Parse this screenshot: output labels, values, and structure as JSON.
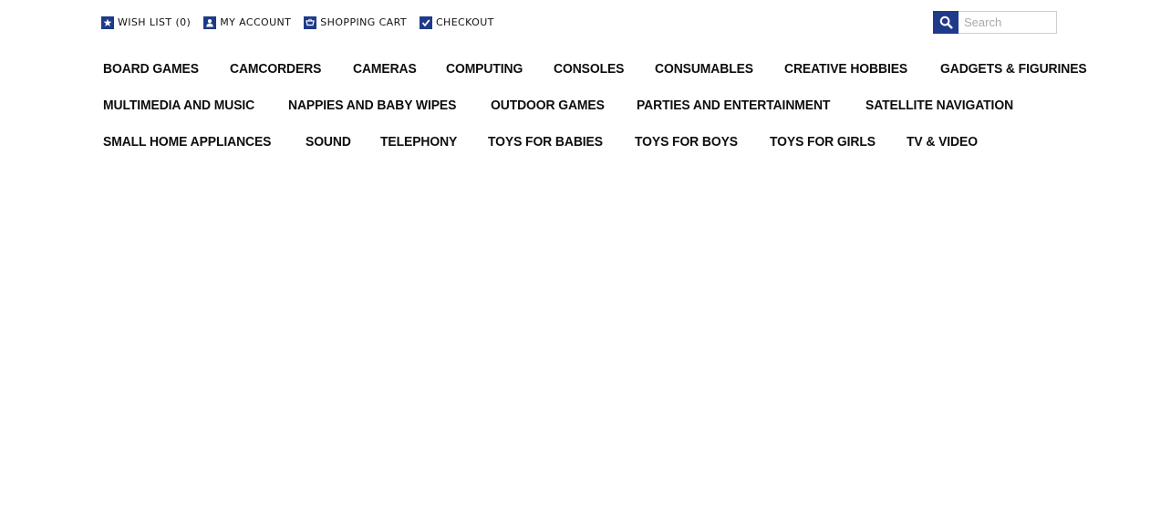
{
  "header": {
    "top_links": [
      {
        "label": "WISH LIST (0)",
        "icon": "star-icon"
      },
      {
        "label": "MY ACCOUNT",
        "icon": "user-icon"
      },
      {
        "label": "SHOPPING CART",
        "icon": "cart-icon"
      },
      {
        "label": "CHECKOUT",
        "icon": "checkmark-icon"
      }
    ],
    "search": {
      "placeholder": "Search",
      "value": "",
      "icon": "search-icon"
    }
  },
  "menu": {
    "rows": [
      [
        "BOARD GAMES",
        "CAMCORDERS",
        "CAMERAS",
        "COMPUTING",
        "CONSOLES",
        "CONSUMABLES",
        "CREATIVE HOBBIES",
        "GADGETS & FIGURINES"
      ],
      [
        "MULTIMEDIA AND MUSIC",
        "NAPPIES AND BABY WIPES",
        "OUTDOOR GAMES",
        "PARTIES AND ENTERTAINMENT",
        "SATELLITE NAVIGATION"
      ],
      [
        "SMALL HOME APPLIANCES",
        "SOUND",
        "TELEPHONY",
        "TOYS FOR BABIES",
        "TOYS FOR BOYS",
        "TOYS FOR GIRLS",
        "TV & VIDEO"
      ]
    ]
  },
  "colors": {
    "accent": "#1e3a8a",
    "text": "#0d0d0d",
    "background": "#ffffff",
    "search_border": "#cfcfcf"
  }
}
